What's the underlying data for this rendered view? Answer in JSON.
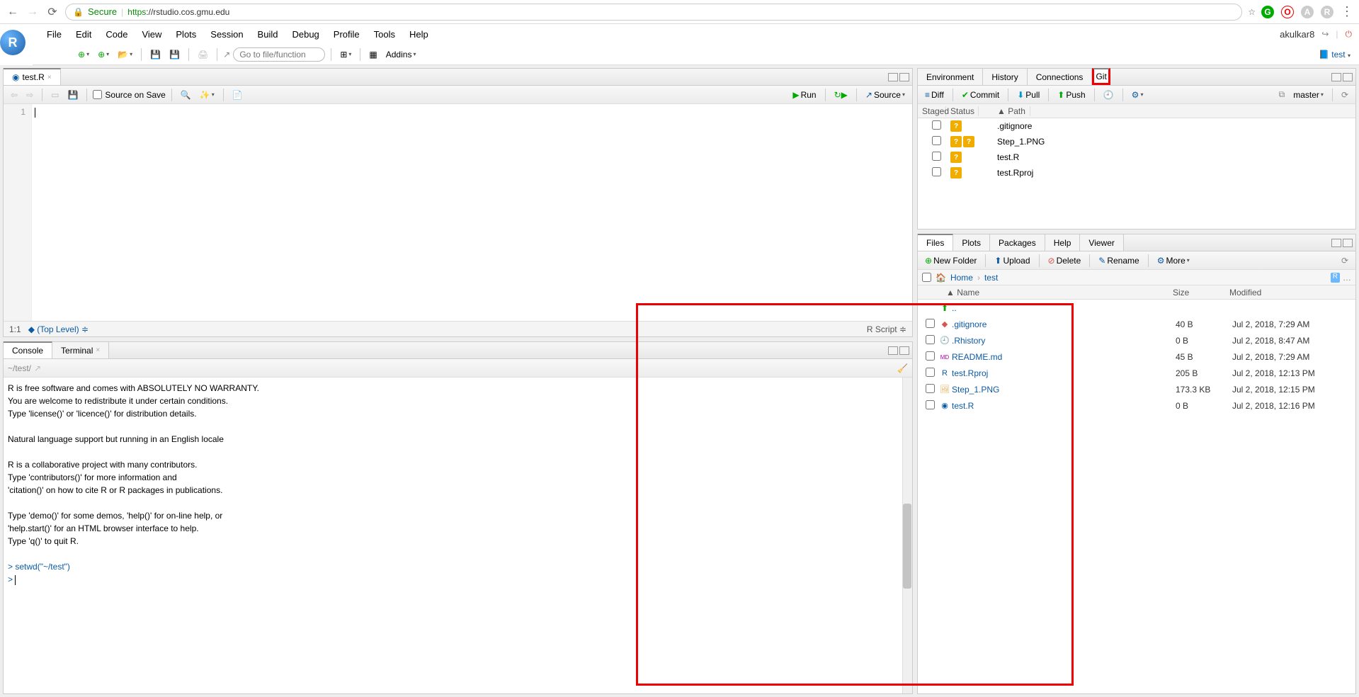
{
  "browser": {
    "secure": "Secure",
    "url_https": "https",
    "url_rest": "://rstudio.cos.gmu.edu"
  },
  "menubar": [
    "File",
    "Edit",
    "Code",
    "View",
    "Plots",
    "Session",
    "Build",
    "Debug",
    "Profile",
    "Tools",
    "Help"
  ],
  "user": "akulkar8",
  "project": "test",
  "gotoPh": "Go to file/function",
  "addins": "Addins",
  "editor": {
    "tab": "test.R",
    "line": "1",
    "pos": "1:1",
    "scope": "(Top Level)",
    "type": "R Script"
  },
  "srcOnSave": "Source on Save",
  "run": "Run",
  "source": "Source",
  "console": {
    "tab1": "Console",
    "tab2": "Terminal",
    "wd": "~/test/",
    "lines": [
      "R is free software and comes with ABSOLUTELY NO WARRANTY.",
      "You are welcome to redistribute it under certain conditions.",
      "Type 'license()' or 'licence()' for distribution details.",
      "",
      "  Natural language support but running in an English locale",
      "",
      "R is a collaborative project with many contributors.",
      "Type 'contributors()' for more information and",
      "'citation()' on how to cite R or R packages in publications.",
      "",
      "Type 'demo()' for some demos, 'help()' for on-line help, or",
      "'help.start()' for an HTML browser interface to help.",
      "Type 'q()' to quit R.",
      ""
    ],
    "cmd": "setwd(\"~/test\")"
  },
  "tr": {
    "tabs": [
      "Environment",
      "History",
      "Connections",
      "Git"
    ],
    "diff": "Diff",
    "commit": "Commit",
    "pull": "Pull",
    "push": "Push",
    "branch": "master",
    "hdr": {
      "staged": "Staged",
      "status": "Status",
      "path": "Path"
    },
    "rows": [
      {
        "s2": false,
        "p": ".gitignore"
      },
      {
        "s2": true,
        "p": "Step_1.PNG"
      },
      {
        "s2": false,
        "p": "test.R"
      },
      {
        "s2": false,
        "p": "test.Rproj"
      }
    ]
  },
  "br": {
    "tabs": [
      "Files",
      "Plots",
      "Packages",
      "Help",
      "Viewer"
    ],
    "newFolder": "New Folder",
    "upload": "Upload",
    "delete": "Delete",
    "rename": "Rename",
    "more": "More",
    "home": "Home",
    "path": "test",
    "hdr": {
      "name": "Name",
      "size": "Size",
      "mod": "Modified"
    },
    "up": "..",
    "rows": [
      {
        "icon": "git",
        "n": ".gitignore",
        "s": "40 B",
        "m": "Jul 2, 2018, 7:29 AM"
      },
      {
        "icon": "clock",
        "n": ".Rhistory",
        "s": "0 B",
        "m": "Jul 2, 2018, 8:47 AM"
      },
      {
        "icon": "md",
        "n": "README.md",
        "s": "45 B",
        "m": "Jul 2, 2018, 7:29 AM"
      },
      {
        "icon": "rproj",
        "n": "test.Rproj",
        "s": "205 B",
        "m": "Jul 2, 2018, 12:13 PM"
      },
      {
        "icon": "img",
        "n": "Step_1.PNG",
        "s": "173.3 KB",
        "m": "Jul 2, 2018, 12:15 PM"
      },
      {
        "icon": "r",
        "n": "test.R",
        "s": "0 B",
        "m": "Jul 2, 2018, 12:16 PM"
      }
    ]
  }
}
